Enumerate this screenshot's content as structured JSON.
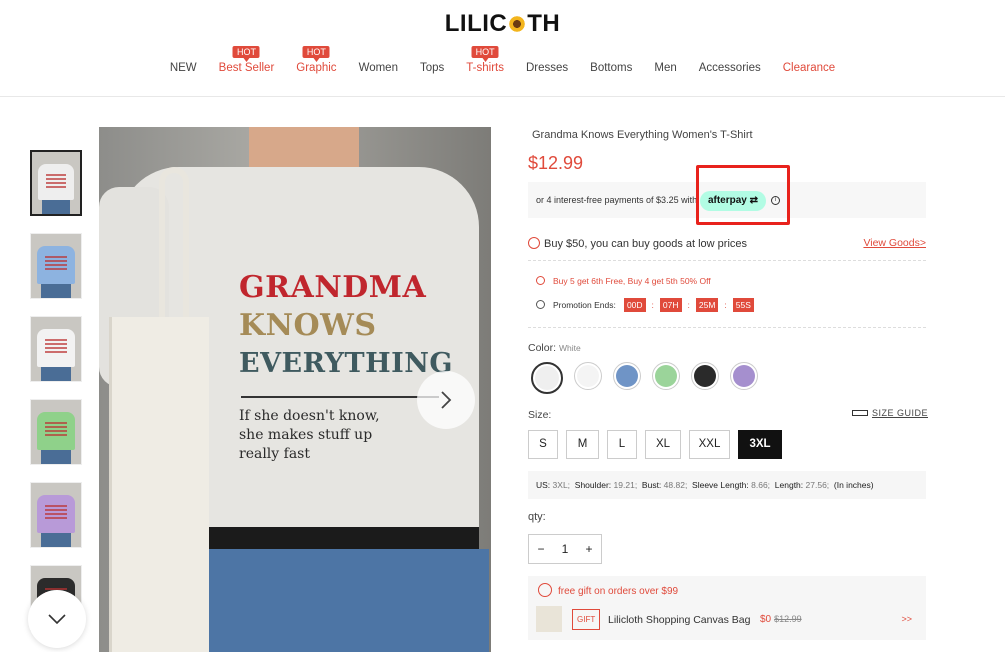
{
  "brand": {
    "logo_left": "LILIC",
    "logo_right": "TH"
  },
  "nav": [
    {
      "label": "NEW",
      "red": false,
      "hot": ""
    },
    {
      "label": "Best Seller",
      "red": true,
      "hot": "HOT"
    },
    {
      "label": "Graphic",
      "red": true,
      "hot": "HOT"
    },
    {
      "label": "Women",
      "red": false,
      "hot": ""
    },
    {
      "label": "Tops",
      "red": false,
      "hot": ""
    },
    {
      "label": "T-shirts",
      "red": true,
      "hot": "HOT"
    },
    {
      "label": "Dresses",
      "red": false,
      "hot": ""
    },
    {
      "label": "Bottoms",
      "red": false,
      "hot": ""
    },
    {
      "label": "Men",
      "red": false,
      "hot": ""
    },
    {
      "label": "Accessories",
      "red": false,
      "hot": ""
    },
    {
      "label": "Clearance",
      "red": true,
      "hot": ""
    }
  ],
  "gallery": {
    "thumb_colors": [
      "#eeeeee",
      "#8db3e0",
      "#f2f2f2",
      "#8fd18a",
      "#b89ad8",
      "#2b2b2b"
    ],
    "print_lines": [
      "GRANDMA",
      "KNOWS",
      "EVERYTHING"
    ],
    "print_colors": [
      "#c0262d",
      "#a58b57",
      "#3f5a5f"
    ],
    "print_sub": [
      "If she doesn't know,",
      "she makes stuff up",
      "really fast"
    ]
  },
  "product": {
    "title": "Grandma Knows Everything Women's T-Shirt",
    "price": "$12.99",
    "installments": "or 4 interest-free payments of $3.25 with",
    "afterpay_label": "afterpay",
    "afterpay_info": "i",
    "buy_promo": "Buy $50, you can buy goods at low prices",
    "view_goods": "View Goods>",
    "deal": "Buy 5 get 6th Free, Buy 4 get 5th 50% Off",
    "promo_ends_label": "Promotion Ends:",
    "countdown": [
      "00D",
      "07H",
      "25M",
      "55S"
    ],
    "countdown_sep": ":",
    "color_label": "Color:",
    "color_value": "White",
    "swatch_colors": [
      "#efefef",
      "#f4f4f4",
      "#6f94c6",
      "#9bd49a",
      "#2a2a2a",
      "#a58fce"
    ],
    "size_label": "Size:",
    "size_guide": "SIZE GUIDE",
    "sizes": [
      "S",
      "M",
      "L",
      "XL",
      "XXL",
      "3XL"
    ],
    "selected_size": "3XL",
    "measurements": [
      {
        "k": "US:",
        "v": "3XL;"
      },
      {
        "k": "Shoulder:",
        "v": "19.21;"
      },
      {
        "k": "Bust:",
        "v": "48.82;"
      },
      {
        "k": "Sleeve Length:",
        "v": "8.66;"
      },
      {
        "k": "Length:",
        "v": "27.56;"
      }
    ],
    "measure_unit": "(In inches)",
    "qty_label": "qty:",
    "qty_value": "1",
    "qty_minus": "−",
    "qty_plus": "+",
    "gift_head": "free gift on orders over $99",
    "gift_tag": "GIFT",
    "gift_name": "Lilicloth Shopping Canvas Bag",
    "gift_price": "$0",
    "gift_orig": "$12.99",
    "gift_more": ">>"
  },
  "colors": {
    "accent": "#e04a3b",
    "afterpay": "#b2fce4",
    "highlight": "#e8221c"
  }
}
